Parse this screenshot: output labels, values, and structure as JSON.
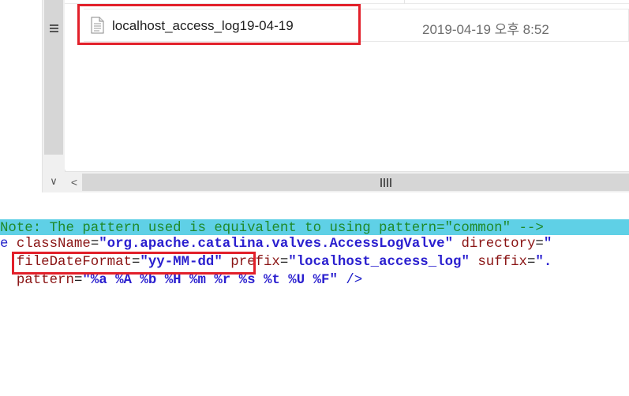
{
  "file_list": {
    "selected_file": {
      "name": "localhost_access_log19-04-19",
      "modified": "2019-04-19 오후 8:52",
      "icon": "text-file-icon"
    }
  },
  "scrollbars": {
    "vertical_grip_icon": "grip-lines-icon",
    "down_arrow": "∨",
    "left_arrow": "<",
    "horizontal_grip_icon": "grip-vertical-icon"
  },
  "code": {
    "line1": "Note: The pattern used is equivalent to using pattern=\"common\" -->",
    "line2": {
      "prefix": "e ",
      "attr1": "className",
      "eq1": "=",
      "val1": "\"org.apache.catalina.valves.AccessLogValve\"",
      "sp": " ",
      "attr2": "directory",
      "eq2": "=",
      "val2": "\""
    },
    "line3": {
      "indent": "  ",
      "attr1": "fileDateFormat",
      "eq1": "=",
      "val1": "\"yy-MM-dd\"",
      "sp": " ",
      "attr2": "prefix",
      "eq2": "=",
      "val2": "\"localhost_access_log\"",
      "sp2": " ",
      "attr3": "suffix",
      "eq3": "=",
      "val3": "\"."
    },
    "line4": {
      "indent": "  ",
      "attr1": "pattern",
      "eq1": "=",
      "val1": "\"%a %A %b %H %m %r %s %t %U %F\"",
      "close": " />"
    }
  },
  "colors": {
    "highlight_box": "#e2202a",
    "cyan_bar": "#5fd0e6",
    "attr_name": "#8a1414",
    "attr_value": "#2a1fcf",
    "comment": "#1f8a2a"
  }
}
